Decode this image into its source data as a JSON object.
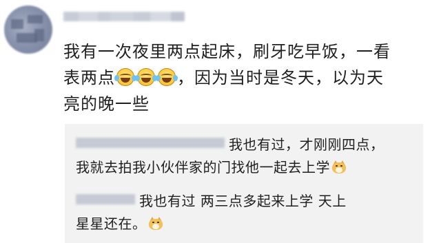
{
  "post": {
    "username_redacted": true,
    "text_line1": "我有一次夜里两点起床，刷牙吃早饭，一看",
    "text_line2_pre": "表两点",
    "text_line2_post": "，因为当时是冬天，以为天",
    "text_line3": "亮的晚一些",
    "emojis": [
      "laugh-cry-icon",
      "laugh-cry-icon",
      "laugh-cry-icon"
    ]
  },
  "replies": [
    {
      "username_redacted": true,
      "line1": "我也有过，才刚刚四点，",
      "line2": "我就去拍我小伙伴家的门找他一起去上学",
      "emoji": "doge-icon"
    },
    {
      "username_redacted": true,
      "line1": "我也有过   两三点多起来上学   天上",
      "line2": "星星还在。",
      "emoji": "doge-icon"
    }
  ],
  "colors": {
    "text": "#1f1f1f",
    "reply_background": "#f2f2f2",
    "redaction": "#c6cad4"
  }
}
